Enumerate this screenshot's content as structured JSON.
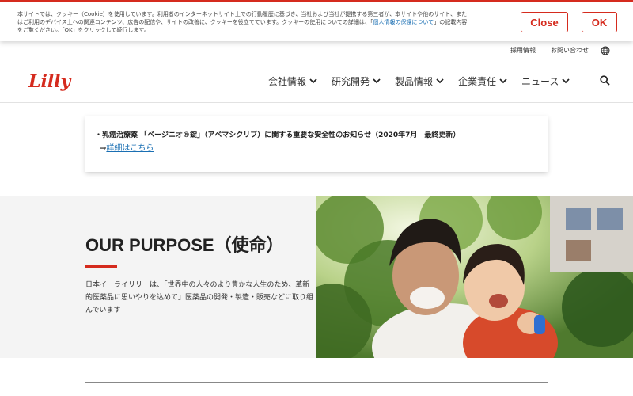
{
  "cookie_banner": {
    "text_line1": "本サイトでは、クッキー（Cookie）を使用しています。利用者のインターネットサイト上での行動履歴に基づき、当社および当社が提携する第三者が、本サイトや他のサイト、また",
    "text_line2_before": "はご利用のデバイス上への関連コンテンツ、広告の配信や、サイトの改善に、クッキーを役立てています。クッキーの使用についての詳細は、「",
    "privacy_link": "個人情報の保護について",
    "text_line2_after": "」の記載内容",
    "text_line3": "をご覧ください。「OK」をクリックして続行します。",
    "close_label": "Close",
    "ok_label": "OK"
  },
  "utility_nav": {
    "careers": "採用情報",
    "contact": "お問い合わせ"
  },
  "header": {
    "logo_text": "Lilly",
    "nav": [
      {
        "label": "会社情報"
      },
      {
        "label": "研究開発"
      },
      {
        "label": "製品情報"
      },
      {
        "label": "企業責任"
      },
      {
        "label": "ニュース"
      }
    ]
  },
  "notice": {
    "line1": "・乳癌治療薬 「ベージニオ®錠」（アベマシクリブ）に関する重要な安全性のお知らせ（2020年7月　最終更新）",
    "arrow": "⇒",
    "link": "詳細はこちら"
  },
  "purpose": {
    "title": "OUR PURPOSE（使命）",
    "description": "日本イーライリリーは、「世界中の人々のより豊かな人生のため、革新的医薬品に思いやりを込めて」医薬品の開発・製造・販売などに取り組んでいます"
  },
  "colors": {
    "brand_red": "#d52b1e",
    "link_blue": "#1a6fb3"
  }
}
